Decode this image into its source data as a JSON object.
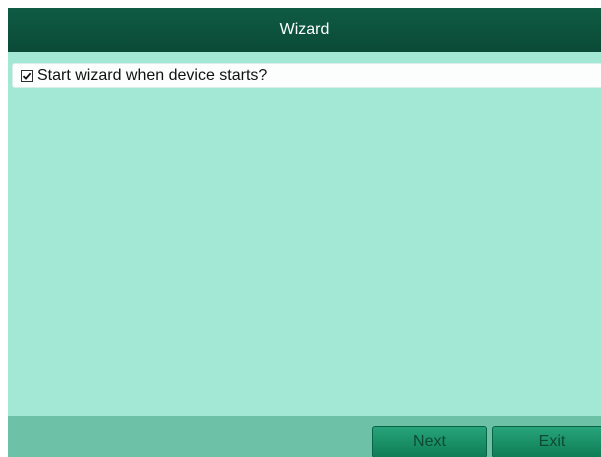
{
  "window": {
    "title": "Wizard"
  },
  "options": {
    "start_wizard_label": "Start wizard when device starts?",
    "start_wizard_checked": true
  },
  "footer": {
    "next_label": "Next",
    "exit_label": "Exit"
  },
  "colors": {
    "title_bar": "#0f5b43",
    "content_background": "#a3e7d5",
    "footer_background": "#6cc1a6",
    "button": "#1b8f66"
  }
}
